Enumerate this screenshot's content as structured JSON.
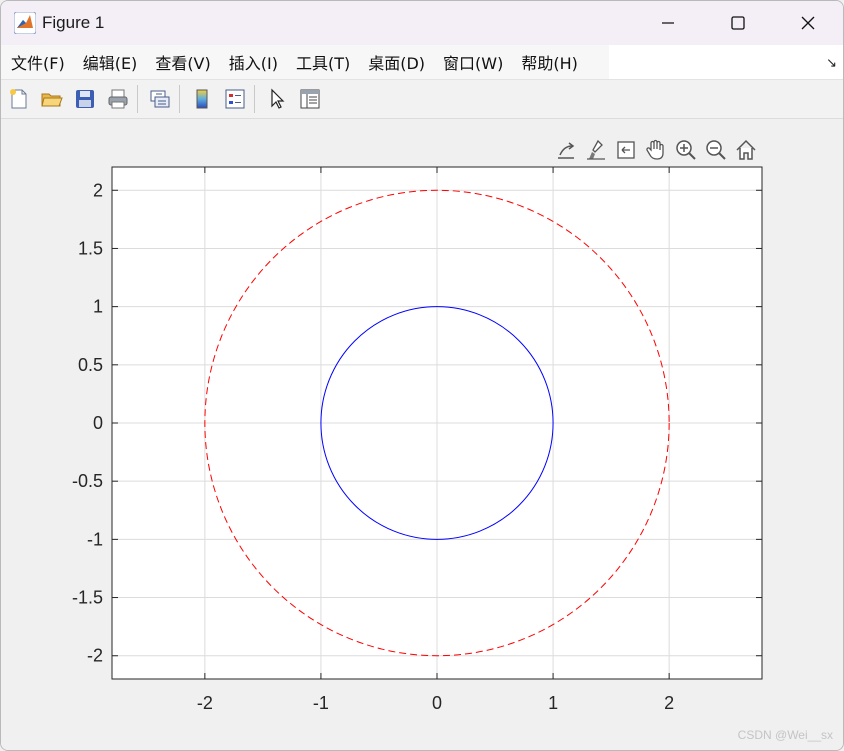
{
  "window": {
    "title": "Figure 1",
    "controls": {
      "minimize": "minimize",
      "maximize": "maximize",
      "close": "close"
    }
  },
  "menubar": {
    "items": [
      "文件(F)",
      "编辑(E)",
      "查看(V)",
      "插入(I)",
      "工具(T)",
      "桌面(D)",
      "窗口(W)",
      "帮助(H)"
    ]
  },
  "toolbar": {
    "icons": [
      "new-figure-icon",
      "open-file-icon",
      "save-icon",
      "print-icon",
      "link-plot-icon",
      "colorbar-icon",
      "legend-icon",
      "edit-plot-arrow-icon",
      "property-inspector-icon"
    ]
  },
  "axes_toolbar": {
    "icons": [
      "export-icon",
      "brush-icon",
      "data-tips-icon",
      "pan-hand-icon",
      "zoom-in-icon",
      "zoom-out-icon",
      "home-icon"
    ]
  },
  "watermark": "CSDN @Wei__sx",
  "colors": {
    "series_inner": "#0000ff",
    "series_outer": "#ff0000",
    "grid": "#dcdcdc",
    "axes": "#262626"
  },
  "chart_data": {
    "type": "line",
    "title": "",
    "xlabel": "",
    "ylabel": "",
    "xlim": [
      -2.8,
      2.8
    ],
    "ylim": [
      -2.2,
      2.2
    ],
    "xticks": [
      -2,
      -1,
      0,
      1,
      2
    ],
    "xtick_labels": [
      "-2",
      "-1",
      "0",
      "1",
      "2"
    ],
    "yticks": [
      2,
      1.5,
      1,
      0.5,
      0,
      -0.5,
      -1,
      -1.5,
      -2
    ],
    "ytick_labels": [
      "2",
      "1.5",
      "1",
      "0.5",
      "0",
      "-0.5",
      "-1",
      "-1.5",
      "-2"
    ],
    "grid": true,
    "series": [
      {
        "shape": "circle",
        "center": [
          0,
          0
        ],
        "radius": 1,
        "color": "#0000ff",
        "line_style": "solid"
      },
      {
        "shape": "circle",
        "center": [
          0,
          0
        ],
        "radius": 2,
        "color": "#ff0000",
        "line_style": "dashed"
      }
    ]
  }
}
